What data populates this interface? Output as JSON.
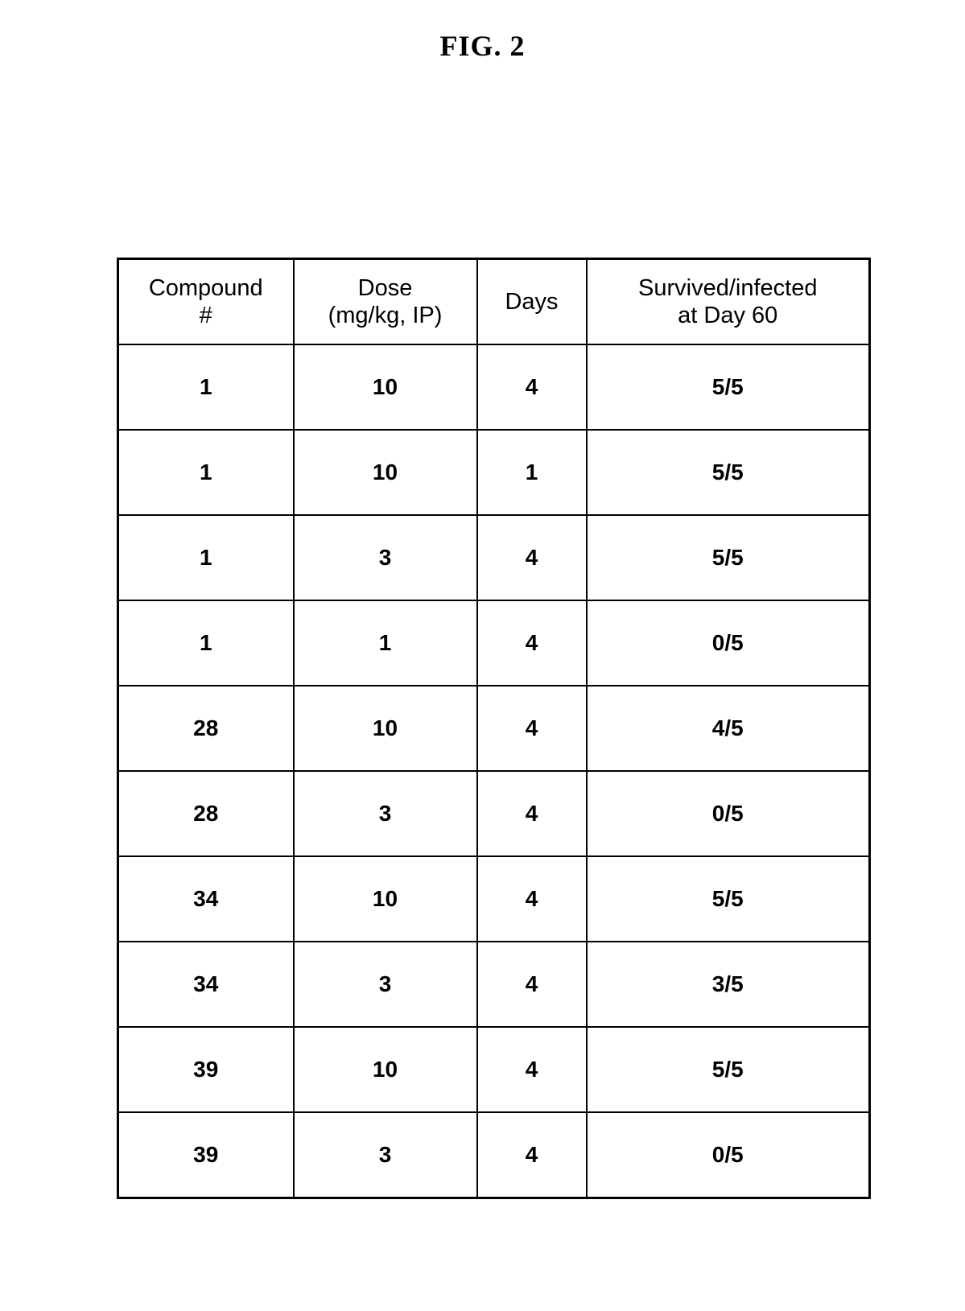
{
  "figure": {
    "title": "FIG. 2"
  },
  "table": {
    "headers": [
      {
        "line1": "Compound",
        "line2": "#"
      },
      {
        "line1": "Dose",
        "line2": "(mg/kg, IP)"
      },
      {
        "line1": "Days",
        "line2": ""
      },
      {
        "line1": "Survived/infected",
        "line2": "at Day 60"
      }
    ],
    "rows": [
      {
        "compound": "1",
        "dose": "10",
        "days": "4",
        "survived": "5/5"
      },
      {
        "compound": "1",
        "dose": "10",
        "days": "1",
        "survived": "5/5"
      },
      {
        "compound": "1",
        "dose": "3",
        "days": "4",
        "survived": "5/5"
      },
      {
        "compound": "1",
        "dose": "1",
        "days": "4",
        "survived": "0/5"
      },
      {
        "compound": "28",
        "dose": "10",
        "days": "4",
        "survived": "4/5"
      },
      {
        "compound": "28",
        "dose": "3",
        "days": "4",
        "survived": "0/5"
      },
      {
        "compound": "34",
        "dose": "10",
        "days": "4",
        "survived": "5/5"
      },
      {
        "compound": "34",
        "dose": "3",
        "days": "4",
        "survived": "3/5"
      },
      {
        "compound": "39",
        "dose": "10",
        "days": "4",
        "survived": "5/5"
      },
      {
        "compound": "39",
        "dose": "3",
        "days": "4",
        "survived": "0/5"
      }
    ]
  },
  "colors": {
    "ink": "#000000",
    "paper": "#ffffff"
  }
}
